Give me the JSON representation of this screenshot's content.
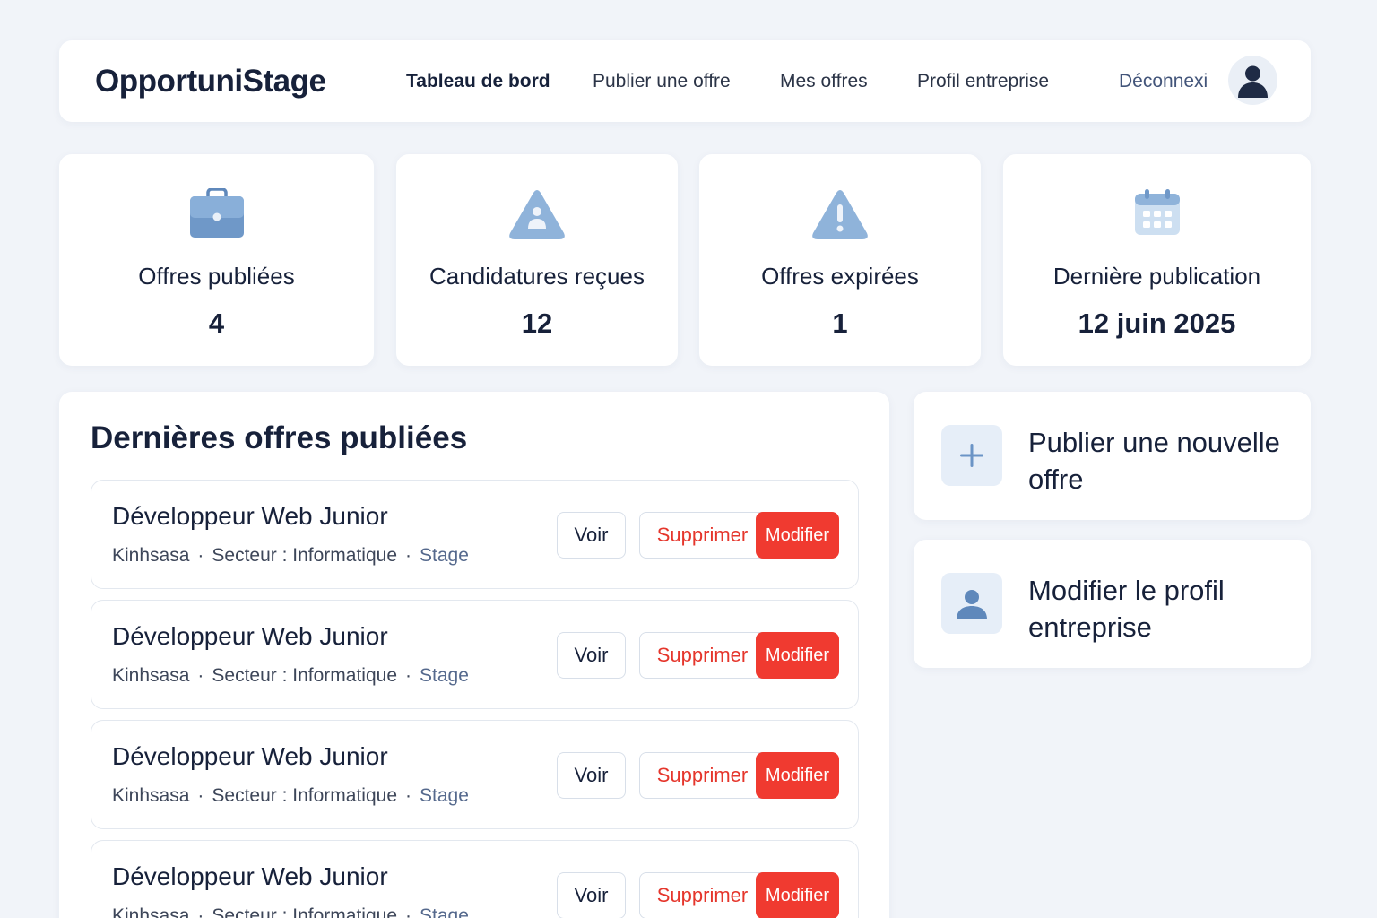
{
  "app": {
    "logo": "OpportuniStage"
  },
  "nav": {
    "items": [
      {
        "label": "Tableau de bord",
        "active": true
      },
      {
        "label": "Publier une offre",
        "active": false
      },
      {
        "label": "Mes offres",
        "active": false
      },
      {
        "label": "Profil entreprise",
        "active": false
      }
    ],
    "logout_label": "Déconnexi"
  },
  "stats": [
    {
      "label": "Offres publiées",
      "value": "4",
      "icon": "briefcase-icon"
    },
    {
      "label": "Candidatures reçues",
      "value": "12",
      "icon": "warning-person-icon"
    },
    {
      "label": "Offres expirées",
      "value": "1",
      "icon": "warning-icon"
    },
    {
      "label": "Dernière publication",
      "value": "12 juin 2025",
      "icon": "calendar-icon"
    }
  ],
  "offers": {
    "title": "Dernières offres publiées",
    "items": [
      {
        "title": "Développeur Web Junior",
        "location": "Kinhsasa",
        "sector": "Secteur : Informatique",
        "type": "Stage"
      },
      {
        "title": "Développeur Web Junior",
        "location": "Kinhsasa",
        "sector": "Secteur : Informatique",
        "type": "Stage"
      },
      {
        "title": "Développeur Web Junior",
        "location": "Kinhsasa",
        "sector": "Secteur : Informatique",
        "type": "Stage"
      },
      {
        "title": "Développeur Web Junior",
        "location": "Kinhsasa",
        "sector": "Secteur : Informatique",
        "type": "Stage"
      }
    ],
    "separator": "·",
    "buttons": {
      "view": "Voir",
      "delete": "Supprimer",
      "edit": "Modifier"
    }
  },
  "actions": [
    {
      "label": "Publier une nouvelle offre",
      "icon": "plus-icon"
    },
    {
      "label": "Modifier le profil entreprise",
      "icon": "user-icon"
    }
  ],
  "colors": {
    "background": "#f1f4f9",
    "accent_icon": "#6b94c6",
    "danger": "#f03a30",
    "text": "#17213a"
  }
}
